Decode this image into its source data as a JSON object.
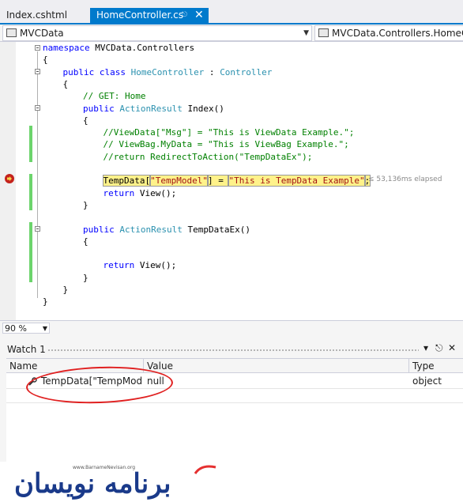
{
  "tabs": [
    {
      "label": "Index.cshtml",
      "active": false
    },
    {
      "label": "HomeController.cs",
      "active": true
    }
  ],
  "nav": {
    "project": "MVCData",
    "member": "MVCData.Controllers.HomeController"
  },
  "code_lines": [
    {
      "indent": 0,
      "tokens": [
        {
          "t": "namespace",
          "c": "kw"
        },
        {
          "t": " MVCData.Controllers"
        }
      ]
    },
    {
      "indent": 0,
      "tokens": [
        {
          "t": "{"
        }
      ]
    },
    {
      "indent": 1,
      "tokens": [
        {
          "t": "public class ",
          "c": "kw"
        },
        {
          "t": "HomeController",
          "c": "ty"
        },
        {
          "t": " : "
        },
        {
          "t": "Controller",
          "c": "ty"
        }
      ]
    },
    {
      "indent": 1,
      "tokens": [
        {
          "t": "{"
        }
      ]
    },
    {
      "indent": 2,
      "tokens": [
        {
          "t": "// GET: Home",
          "c": "cm"
        }
      ]
    },
    {
      "indent": 2,
      "tokens": [
        {
          "t": "public ",
          "c": "kw"
        },
        {
          "t": "ActionResult",
          "c": "ty"
        },
        {
          "t": " Index()"
        }
      ]
    },
    {
      "indent": 2,
      "tokens": [
        {
          "t": "{"
        }
      ]
    },
    {
      "indent": 3,
      "tokens": [
        {
          "t": "//ViewData[\"Msg\"] = \"This is ViewData Example.\";",
          "c": "cm"
        }
      ]
    },
    {
      "indent": 3,
      "tokens": [
        {
          "t": "// ViewBag.MyData = \"This is ViewBag Example.\";",
          "c": "cm"
        }
      ]
    },
    {
      "indent": 3,
      "tokens": [
        {
          "t": "//return RedirectToAction(\"TempDataEx\");",
          "c": "cm"
        }
      ]
    },
    {
      "indent": 0,
      "tokens": []
    },
    {
      "indent": 3,
      "tokens": [
        {
          "t": "TempData[",
          "c": "hl"
        },
        {
          "t": "\"TempModel\"",
          "c": "hl st"
        },
        {
          "t": "] = ",
          "c": "hl"
        },
        {
          "t": "\"This is TempData Example\"",
          "c": "hl st"
        },
        {
          "t": ";",
          "c": "hl"
        }
      ]
    },
    {
      "indent": 3,
      "tokens": [
        {
          "t": "return ",
          "c": "kw"
        },
        {
          "t": "View();"
        }
      ]
    },
    {
      "indent": 2,
      "tokens": [
        {
          "t": "}"
        }
      ]
    },
    {
      "indent": 0,
      "tokens": []
    },
    {
      "indent": 2,
      "tokens": [
        {
          "t": "public ",
          "c": "kw"
        },
        {
          "t": "ActionResult",
          "c": "ty"
        },
        {
          "t": " TempDataEx()"
        }
      ]
    },
    {
      "indent": 2,
      "tokens": [
        {
          "t": "{"
        }
      ]
    },
    {
      "indent": 0,
      "tokens": []
    },
    {
      "indent": 3,
      "tokens": [
        {
          "t": "return ",
          "c": "kw"
        },
        {
          "t": "View();"
        }
      ]
    },
    {
      "indent": 2,
      "tokens": [
        {
          "t": "}"
        }
      ]
    },
    {
      "indent": 1,
      "tokens": [
        {
          "t": "}"
        }
      ]
    },
    {
      "indent": 0,
      "tokens": [
        {
          "t": "}"
        }
      ]
    }
  ],
  "elapsed": "≤ 53,136ms elapsed",
  "zoom": "90 %",
  "watch": {
    "title": "Watch 1",
    "columns": [
      "Name",
      "Value",
      "Type"
    ],
    "rows": [
      {
        "name": "TempData[\"TempModel\"]",
        "value": "null",
        "type": "object"
      }
    ]
  },
  "watermark": {
    "url": "www.BarnameNevisan.org",
    "text": "برنامه نویسان"
  },
  "colors": {
    "accent": "#007acc",
    "highlight": "#fff28a",
    "annotation": "#e02020"
  }
}
